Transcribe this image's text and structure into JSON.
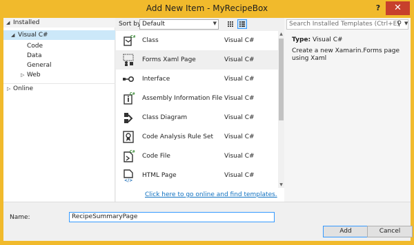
{
  "window": {
    "title": "Add New Item - MyRecipeBox",
    "help_glyph": "?",
    "close_glyph": "✕"
  },
  "tree": {
    "installed": "Installed",
    "visual_csharp": "Visual C#",
    "children": [
      "Code",
      "Data",
      "General",
      "Web"
    ],
    "online": "Online"
  },
  "sortbar": {
    "label": "Sort by:",
    "value": "Default"
  },
  "templates": [
    {
      "name": "Class",
      "lang": "Visual C#",
      "icon": "class-icon"
    },
    {
      "name": "Forms Xaml Page",
      "lang": "Visual C#",
      "icon": "forms-xaml-page-icon"
    },
    {
      "name": "Interface",
      "lang": "Visual C#",
      "icon": "interface-icon"
    },
    {
      "name": "Assembly Information File",
      "lang": "Visual C#",
      "icon": "assembly-info-icon"
    },
    {
      "name": "Class Diagram",
      "lang": "Visual C#",
      "icon": "class-diagram-icon"
    },
    {
      "name": "Code Analysis Rule Set",
      "lang": "Visual C#",
      "icon": "rule-set-icon"
    },
    {
      "name": "Code File",
      "lang": "Visual C#",
      "icon": "code-file-icon"
    },
    {
      "name": "HTML Page",
      "lang": "Visual C#",
      "icon": "html-page-icon"
    }
  ],
  "selected_template": "Forms Xaml Page",
  "online_link": "Click here to go online and find templates.",
  "search": {
    "placeholder": "Search Installed Templates (Ctrl+E)"
  },
  "details": {
    "type_label": "Type:",
    "type_value": "Visual C#",
    "description": "Create a new Xamarin.Forms page using Xaml"
  },
  "name_field": {
    "label": "Name:",
    "value": "RecipeSummaryPage"
  },
  "buttons": {
    "add": "Add",
    "cancel": "Cancel"
  },
  "colors": {
    "title_bar": "#f1ba2c",
    "close_button": "#c7402c",
    "selection": "#cce8f9",
    "link": "#0e70c0",
    "focus_border": "#3399ff"
  }
}
